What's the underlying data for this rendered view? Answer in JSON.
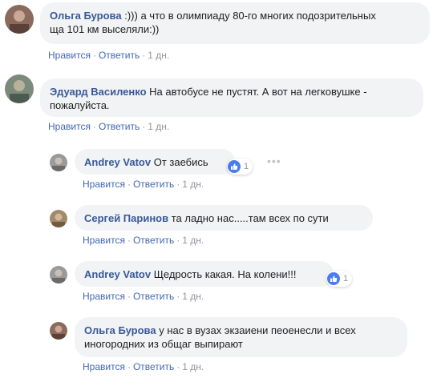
{
  "actions": {
    "like": "Нравится",
    "reply": "Ответить",
    "separator": "·"
  },
  "comments": [
    {
      "author": "Ольга Бурова",
      "text": ":))) а что в олимпиаду 80-го многих подозрительных ща 101 км выселяли:))",
      "line1": " :))) а что в олимпиаду 80-го многих подозрительных",
      "line2": "ща 101 км выселяли:))",
      "time": "1 дн."
    },
    {
      "author": "Эдуард Василенко",
      "line1": " На автобусе не пустят. А вот на легковушке -",
      "line2": "пожалуйста.",
      "time": "1 дн."
    },
    {
      "author": "Andrey Vatov",
      "text": " От заебись",
      "time": "1 дн.",
      "reactions": "1"
    },
    {
      "author": "Сергей Паринов",
      "text": " та ладно нас.....там всех по сути",
      "time": "1 дн."
    },
    {
      "author": "Andrey Vatov",
      "text": " Щедрость какая. На колени!!!",
      "time": "1 дн.",
      "reactions": "1"
    },
    {
      "author": "Ольга Бурова",
      "line1": " у нас в вузах экзаиени пеоенесли и всех",
      "line2": "иногородних из общаг выпирают",
      "time": "1 дн."
    }
  ],
  "more_glyph": "•••",
  "colors": {
    "link": "#4267b2",
    "author": "#385898",
    "bubble": "#f2f3f5",
    "meta": "#90949c",
    "like": "#4a7bf0"
  }
}
